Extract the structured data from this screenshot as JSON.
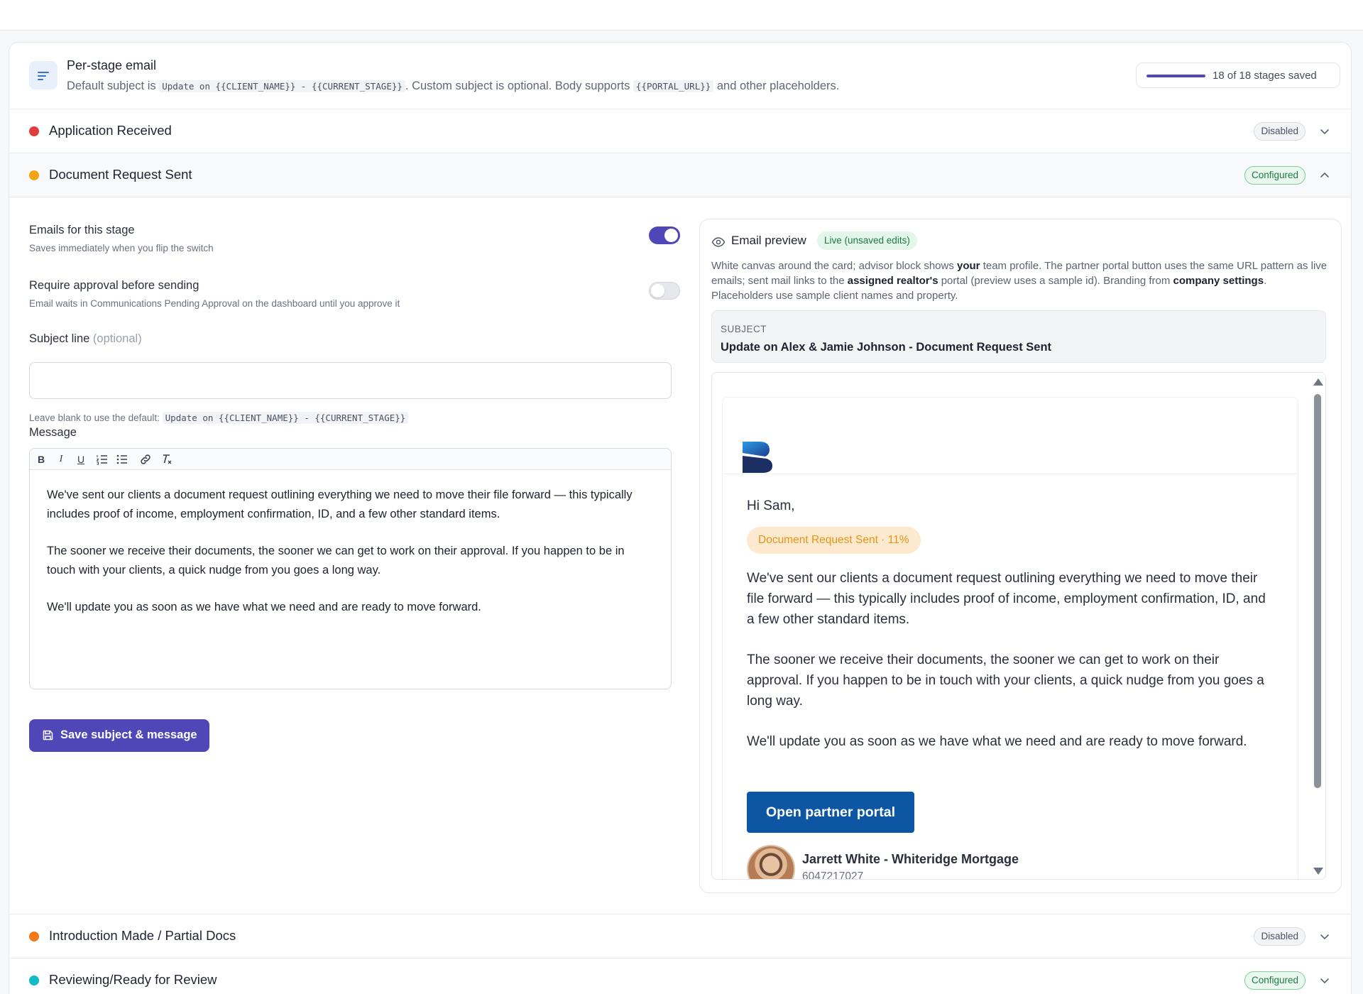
{
  "header": {
    "title": "Per-stage email",
    "desc_prefix": "Default subject is",
    "desc_code_default": "Update on {{CLIENT_NAME}} - {{CURRENT_STAGE}}",
    "desc_middle": ". Custom subject is optional. Body supports",
    "desc_code_portal": "{{PORTAL_URL}}",
    "desc_suffix": "and other placeholders.",
    "progress_text": "18 of 18 stages saved",
    "progress_fraction": 1.0,
    "icon": "text-lines-icon"
  },
  "stages": [
    {
      "name": "Application Received",
      "status": "Disabled",
      "dot_color": "#e03d3d",
      "expanded": false
    },
    {
      "name": "Document Request Sent",
      "status": "Configured",
      "dot_color": "#f2a413",
      "expanded": true
    },
    {
      "name": "Introduction Made / Partial Docs",
      "status": "Disabled",
      "dot_color": "#f07a1c",
      "expanded": false
    },
    {
      "name": "Reviewing/Ready for Review",
      "status": "Configured",
      "dot_color": "#14b8c8",
      "expanded": false
    }
  ],
  "editor": {
    "emails_label": "Emails for this stage",
    "emails_sub": "Saves immediately when you flip the switch",
    "emails_enabled": true,
    "approval_label": "Require approval before sending",
    "approval_sub": "Email waits in Communications Pending Approval on the dashboard until you approve it",
    "approval_enabled": false,
    "subject_label": "Subject line",
    "subject_optional": "(optional)",
    "subject_value": "",
    "subject_hint": "Leave blank to use the default:",
    "subject_hint_code": "Update on {{CLIENT_NAME}} - {{CURRENT_STAGE}}",
    "message_label": "Message",
    "toolbar": [
      "B",
      "I",
      "U",
      "ordered-list",
      "bullet-list",
      "link",
      "clear-format"
    ],
    "message_paragraphs": [
      "We've sent our clients a document request outlining everything we need to move their file forward — this typically includes proof of income, employment confirmation, ID, and a few other standard items.",
      "The sooner we receive their documents, the sooner we can get to work on their approval. If you happen to be in touch with your clients, a quick nudge from you goes a long way.",
      "We'll update you as soon as we have what we need and are ready to move forward."
    ],
    "save_label": "Save subject & message"
  },
  "preview": {
    "title": "Email preview",
    "live_badge": "Live (unsaved edits)",
    "desc_1": "White canvas around the card; advisor block shows",
    "desc_b1": "your",
    "desc_2": "team profile. The partner portal button uses the same URL pattern as live emails; sent mail links to the",
    "desc_b2": "assigned realtor's",
    "desc_3": "portal (preview uses a sample id). Branding from",
    "desc_b3": "company settings",
    "desc_4": ". Placeholders use sample client names and property.",
    "subject_caption": "SUBJECT",
    "subject_value": "Update on Alex & Jamie Johnson - Document Request Sent",
    "greeting": "Hi Sam,",
    "stage_chip": "Document Request Sent · 11%",
    "portal_button": "Open partner portal",
    "advisor_name": "Jarrett White - Whiteridge Mortgage",
    "advisor_phone": "6047217027"
  },
  "colors": {
    "accent": "#4f46b8",
    "portal_button": "#0c56a3",
    "configured": "#1d7a43",
    "chip_bg": "#fde9cd",
    "chip_text": "#e49519"
  }
}
